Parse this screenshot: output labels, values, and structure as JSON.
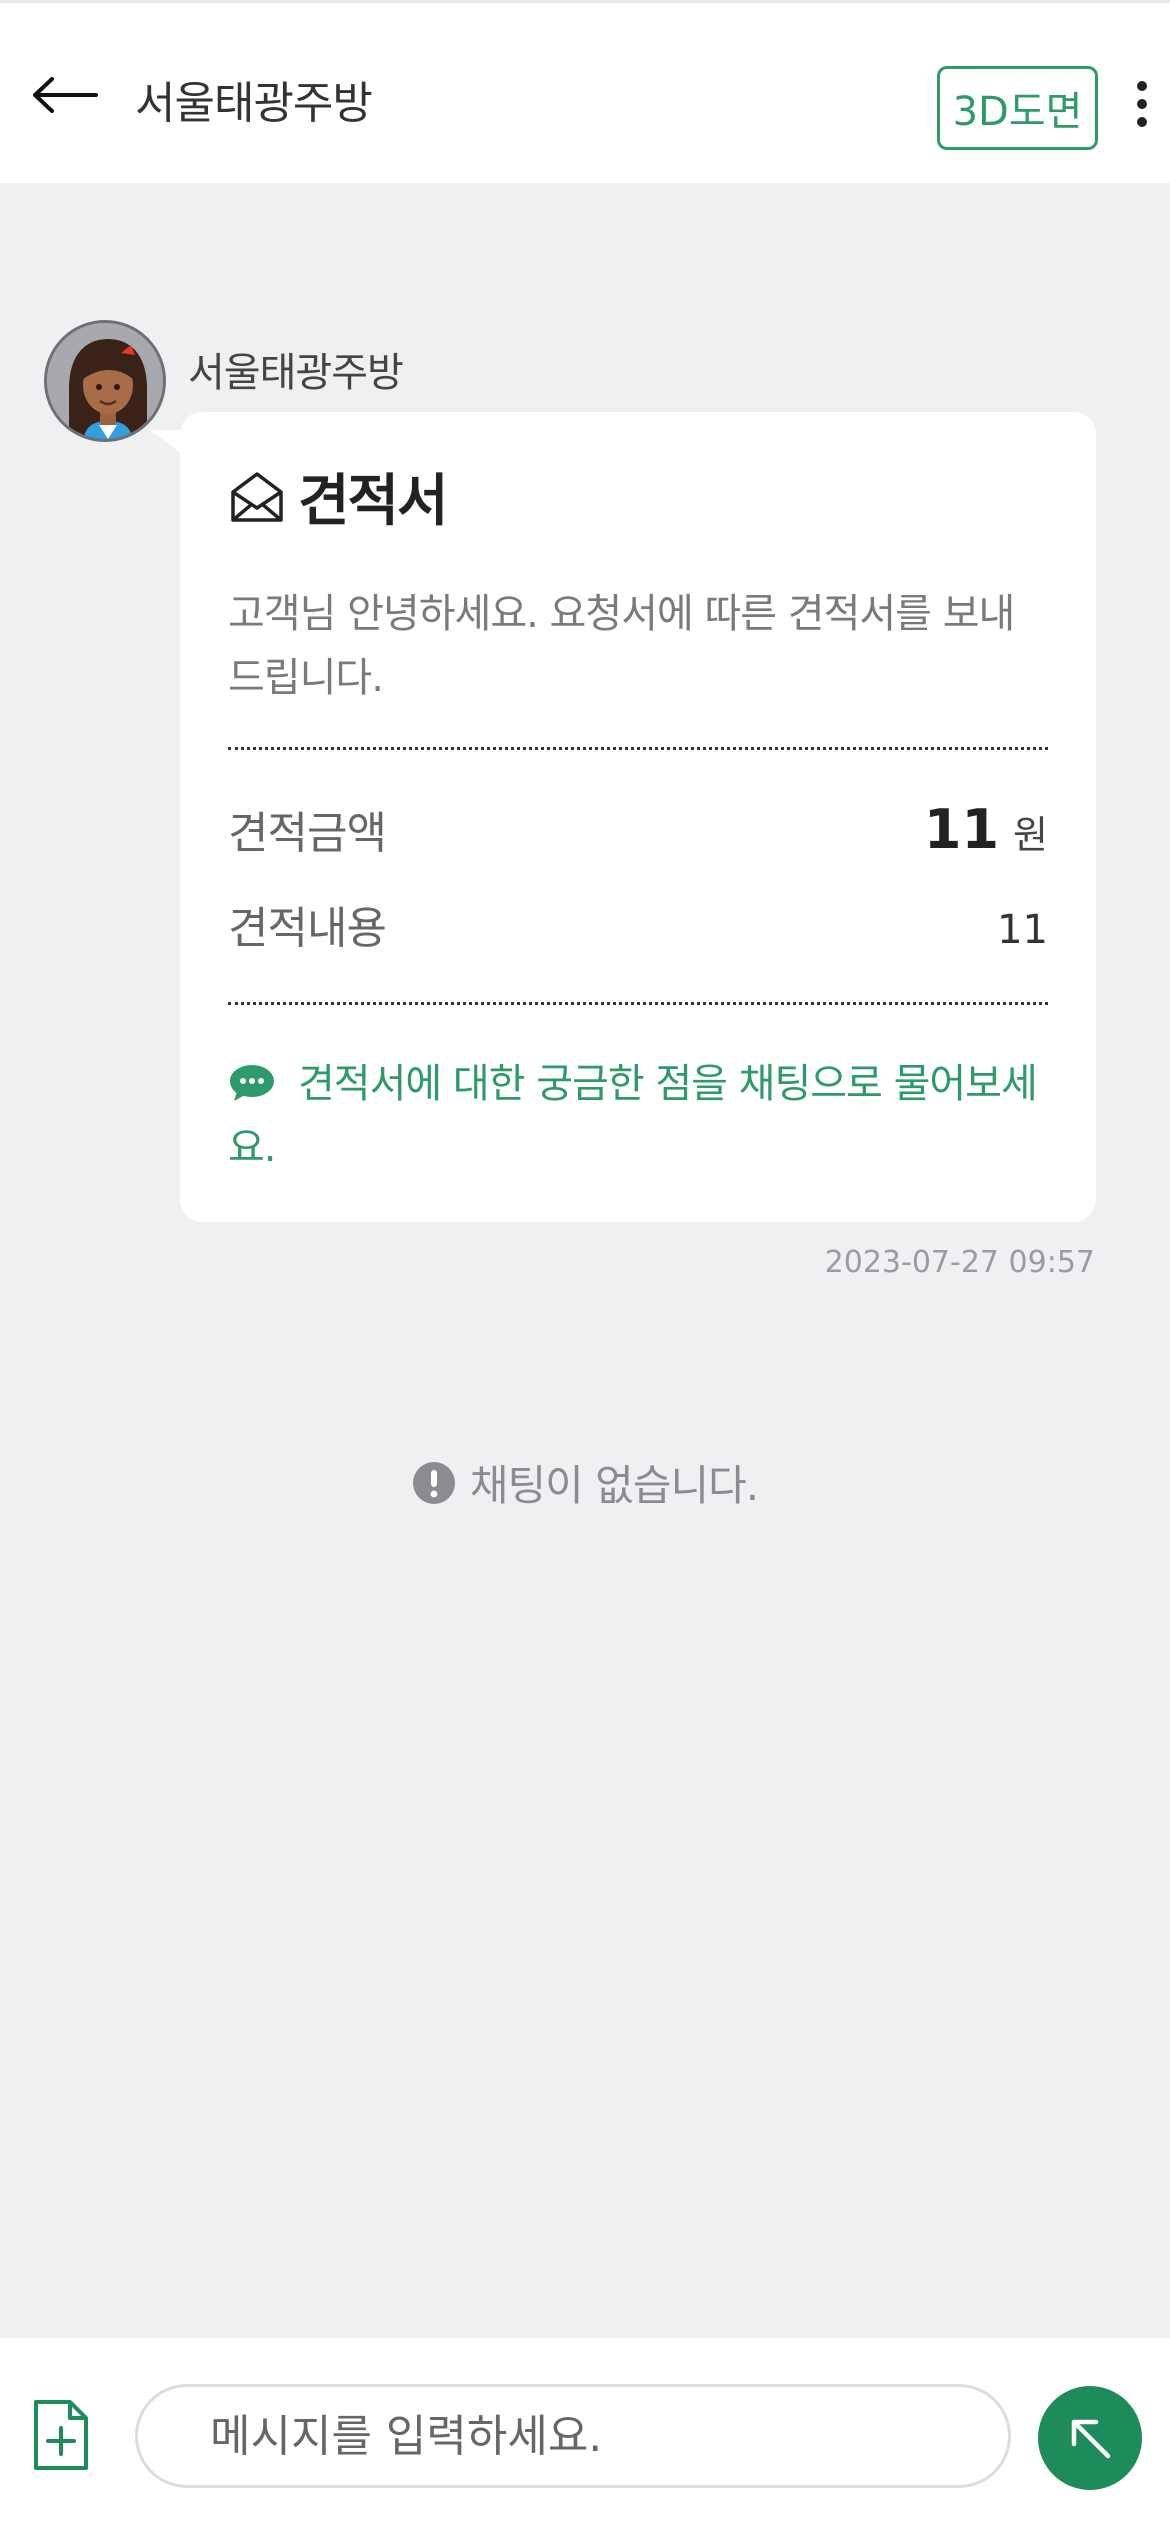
{
  "header": {
    "title": "서울태광주방",
    "button_3d": "3D도면",
    "back_icon": "arrow-left-icon",
    "more_icon": "more-vertical-icon"
  },
  "message": {
    "sender": "서울태광주방",
    "card": {
      "title": "견적서",
      "title_icon": "envelope-open-icon",
      "description": "고객님 안녕하세요. 요청서에 따른 견적서를 보내 드립니다.",
      "rows": [
        {
          "label": "견적금액",
          "value": "11",
          "unit": "원"
        },
        {
          "label": "견적내용",
          "value": "11"
        }
      ],
      "hint": "견적서에 대한 궁금한 점을 채팅으로 물어보세요.",
      "hint_icon": "chat-bubble-icon"
    },
    "timestamp": "2023-07-27 09:57"
  },
  "empty_state": {
    "text": "채팅이 없습니다.",
    "icon": "alert-circle-icon"
  },
  "composer": {
    "placeholder": "메시지를 입력하세요.",
    "attach_icon": "file-add-icon",
    "send_icon": "arrow-up-left-icon"
  },
  "colors": {
    "accent": "#2e9a6a",
    "send_button": "#1e8c5a",
    "background": "#eef0f2"
  }
}
